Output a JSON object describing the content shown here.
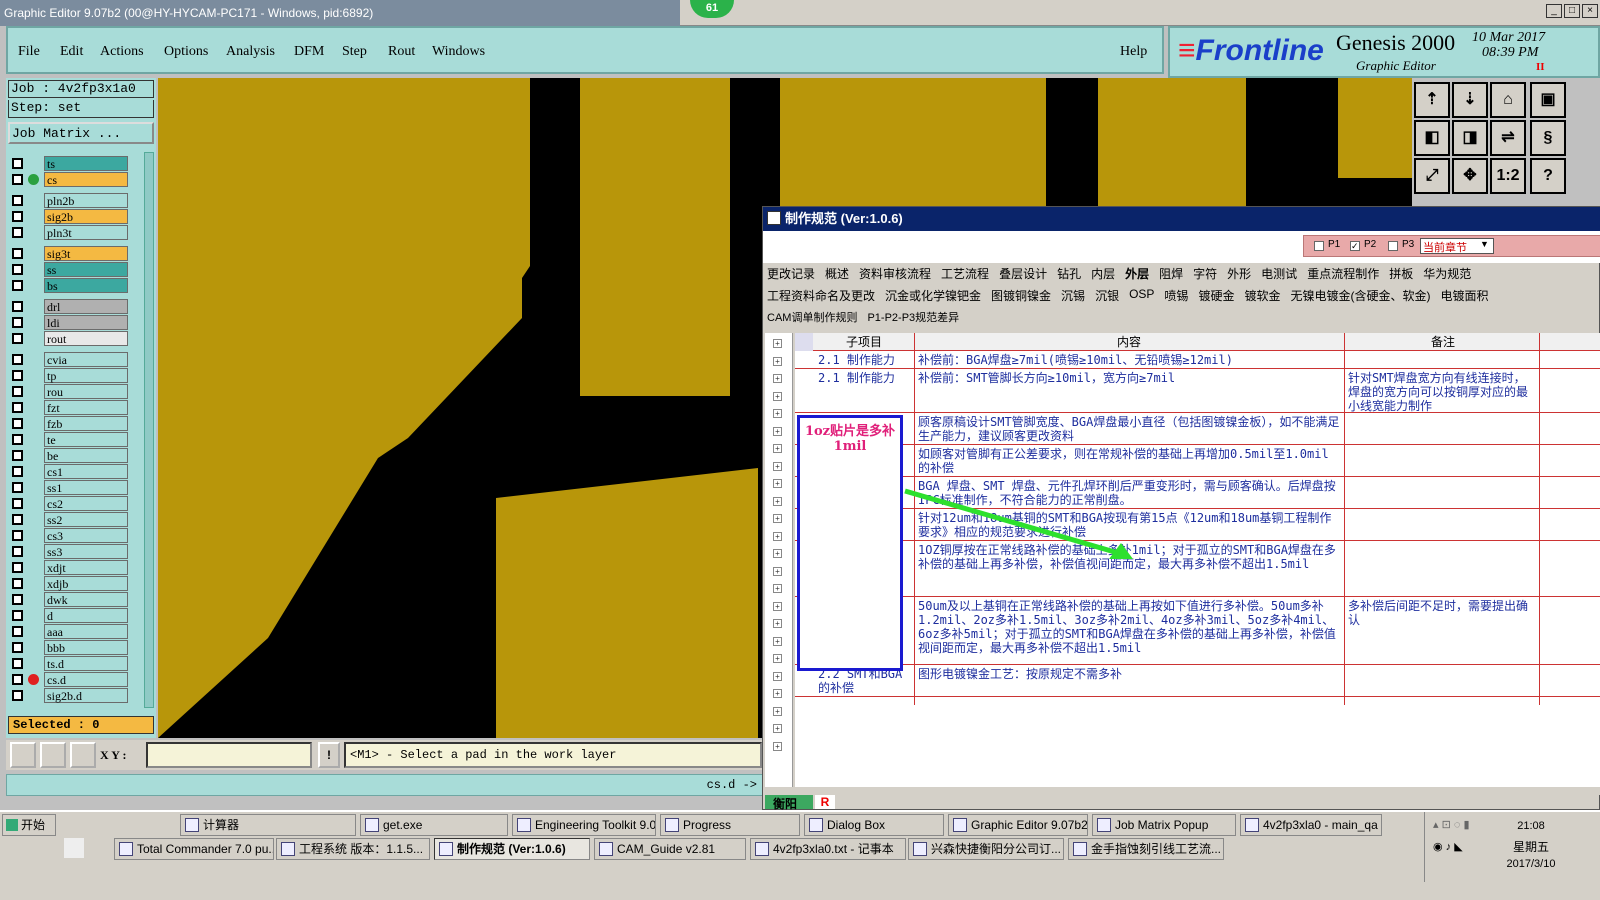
{
  "window": {
    "title": "Graphic Editor 9.07b2 (00@HY-HYCAM-PC171 - Windows, pid:6892)",
    "badge": "61"
  },
  "menu": {
    "items": [
      "File",
      "Edit",
      "Actions",
      "Options",
      "Analysis",
      "DFM",
      "Step",
      "Rout",
      "Windows"
    ],
    "help": "Help"
  },
  "brand": {
    "logo": "Frontline",
    "product": "Genesis 2000",
    "sub": "Graphic Editor",
    "date": "10 Mar 2017",
    "time": "08:39 PM",
    "indicator": "II"
  },
  "job": {
    "job_label": "Job : 4v2fp3x1a0",
    "step_label": "Step: set",
    "matrix_btn": "Job Matrix ..."
  },
  "layers": [
    {
      "name": "ts",
      "color": "#3ca8a0",
      "dot": ""
    },
    {
      "name": "cs",
      "color": "#f4b942",
      "dot": "#2aa040"
    },
    {
      "name": "pln2b",
      "color": "#a8dcd8",
      "dot": ""
    },
    {
      "name": "sig2b",
      "color": "#f4b942",
      "dot": ""
    },
    {
      "name": "pln3t",
      "color": "#a8dcd8",
      "dot": ""
    },
    {
      "name": "sig3t",
      "color": "#f4b942",
      "dot": ""
    },
    {
      "name": "ss",
      "color": "#3ca8a0",
      "dot": ""
    },
    {
      "name": "bs",
      "color": "#3ca8a0",
      "dot": ""
    },
    {
      "name": "drl",
      "color": "#b0b0b0",
      "dot": ""
    },
    {
      "name": "ldi",
      "color": "#b0b0b0",
      "dot": ""
    },
    {
      "name": "rout",
      "color": "#e8e8e8",
      "dot": ""
    },
    {
      "name": "cvia",
      "color": "#a8dcd8",
      "dot": ""
    },
    {
      "name": "tp",
      "color": "#a8dcd8",
      "dot": ""
    },
    {
      "name": "rou",
      "color": "#a8dcd8",
      "dot": ""
    },
    {
      "name": "fzt",
      "color": "#a8dcd8",
      "dot": ""
    },
    {
      "name": "fzb",
      "color": "#a8dcd8",
      "dot": ""
    },
    {
      "name": "te",
      "color": "#a8dcd8",
      "dot": ""
    },
    {
      "name": "be",
      "color": "#a8dcd8",
      "dot": ""
    },
    {
      "name": "cs1",
      "color": "#a8dcd8",
      "dot": ""
    },
    {
      "name": "ss1",
      "color": "#a8dcd8",
      "dot": ""
    },
    {
      "name": "cs2",
      "color": "#a8dcd8",
      "dot": ""
    },
    {
      "name": "ss2",
      "color": "#a8dcd8",
      "dot": ""
    },
    {
      "name": "cs3",
      "color": "#a8dcd8",
      "dot": ""
    },
    {
      "name": "ss3",
      "color": "#a8dcd8",
      "dot": ""
    },
    {
      "name": "xdjt",
      "color": "#a8dcd8",
      "dot": ""
    },
    {
      "name": "xdjb",
      "color": "#a8dcd8",
      "dot": ""
    },
    {
      "name": "dwk",
      "color": "#a8dcd8",
      "dot": ""
    },
    {
      "name": "d",
      "color": "#a8dcd8",
      "dot": ""
    },
    {
      "name": "aaa",
      "color": "#a8dcd8",
      "dot": ""
    },
    {
      "name": "bbb",
      "color": "#a8dcd8",
      "dot": ""
    },
    {
      "name": "ts.d",
      "color": "#a8dcd8",
      "dot": ""
    },
    {
      "name": "cs.d",
      "color": "#a8dcd8",
      "dot": "#e02020"
    },
    {
      "name": "sig2b.d",
      "color": "#a8dcd8",
      "dot": ""
    }
  ],
  "selected": "Selected : 0",
  "status": {
    "xy_label": "X Y :",
    "prompt": "<M1> - Select a pad in the work layer",
    "layer_ref": "cs.d ->"
  },
  "dialog": {
    "title": "制作规范 (Ver:1.0.6)",
    "checks": [
      "P1",
      "P2",
      "P3"
    ],
    "chapter": "当前章节",
    "tabs1": [
      "更改记录",
      "概述",
      "资料审核流程",
      "工艺流程",
      "叠层设计",
      "钻孔",
      "内层",
      "外层",
      "阻焊",
      "字符",
      "外形",
      "电测试",
      "重点流程制作",
      "拼板",
      "华为规范"
    ],
    "tabs2": [
      "工程资料命名及更改",
      "沉金或化学镍钯金",
      "图镀铜镍金",
      "沉锡",
      "沉银",
      "OSP",
      "喷锡",
      "镀硬金",
      "镀软金",
      "无镍电镀金(含硬金、软金)",
      "电镀面积"
    ],
    "tabs3": [
      "CAM调单制作规则",
      "P1-P2-P3规范差异"
    ],
    "headers": [
      "子项目",
      "内容",
      "备注"
    ],
    "rows": [
      {
        "sub": "2.1 制作能力",
        "content": "补偿前：BGA焊盘≥7mil(喷锡≥10mil、无铅喷锡≥12mil)",
        "note": ""
      },
      {
        "sub": "2.1 制作能力",
        "content": "补偿前：SMT管脚长方向≥10mil，宽方向≥7mil",
        "note": "针对SMT焊盘宽方向有线连接时，焊盘的宽方向可以按铜厚对应的最小线宽能力制作"
      },
      {
        "sub": "",
        "content": "顾客原稿设计SMT管脚宽度、BGA焊盘最小直径（包括图镀镍金板），如不能满足生产能力，建议顾客更改资料",
        "note": ""
      },
      {
        "sub": "",
        "content": "如顾客对管脚有正公差要求，则在常规补偿的基础上再增加0.5mil至1.0mil的补偿",
        "note": ""
      },
      {
        "sub": "",
        "content": "BGA 焊盘、SMT 焊盘、元件孔焊环削后严重变形时，需与顾客确认。后焊盘按IPC标准制作，不符合能力的正常削盘。",
        "note": ""
      },
      {
        "sub": "",
        "content": "针对12um和18um基铜的SMT和BGA按现有第15点《12um和18um基铜工程制作要求》相应的规范要求进行补偿",
        "note": ""
      },
      {
        "sub": "",
        "content": "1OZ铜厚按在正常线路补偿的基础上多补1mil；对于孤立的SMT和BGA焊盘在多补偿的基础上再多补偿，补偿值视间距而定，最大再多补偿不超出1.5mil",
        "note": ""
      },
      {
        "sub": "",
        "content": "50um及以上基铜在正常线路补偿的基础上再按如下值进行多补偿。50um多补1.2mil、2oz多补1.5mil、3oz多补2mil、4oz多补3mil、5oz多补4mil、6oz多补5mil；对于孤立的SMT和BGA焊盘在多补偿的基础上再多补偿，补偿值视间距而定，最大再多补偿不超出1.5mil",
        "note": "多补偿后间距不足时，需要提出确认"
      },
      {
        "sub": "2.2 SMT和BGA的补偿",
        "content": "图形电镀镍金工艺：按原规定不需多补",
        "note": ""
      }
    ],
    "annotation": "1oz贴片是多补1mil",
    "bottom_tabs": [
      "衡阳",
      "R"
    ]
  },
  "taskbar": {
    "start": "开始",
    "row1": [
      "计算器",
      "get.exe",
      "Engineering Toolkit 9.0...",
      "Progress",
      "Dialog Box",
      "Graphic Editor 9.07b2 ...",
      "Job Matrix Popup",
      "4v2fp3xla0 - main_qa"
    ],
    "row2": [
      "Total Commander 7.0 pu...",
      "工程系统  版本：1.1.5...",
      "制作规范 (Ver:1.0.6)",
      "CAM_Guide v2.81",
      "4v2fp3xla0.txt - 记事本",
      "兴森快捷衡阳分公司订...",
      "金手指蚀刻引线工艺流..."
    ],
    "clock": "21:08",
    "weekday": "星期五",
    "date": "2017/3/10"
  }
}
